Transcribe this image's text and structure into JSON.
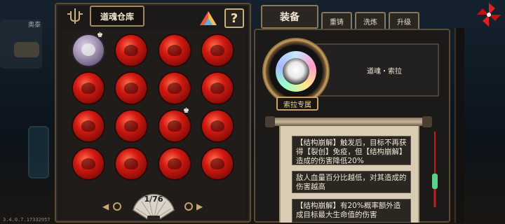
{
  "backdrop": {
    "overhead_label": "奥泰",
    "version": "3.4.0.7.17332957"
  },
  "left_panel": {
    "title": "道魂仓库",
    "help_label": "?",
    "page": "1/76",
    "prev_label": "◀",
    "next_label": "▶"
  },
  "orbs": [
    {
      "kind": "gray",
      "badge": "♚"
    },
    {
      "kind": "red"
    },
    {
      "kind": "red"
    },
    {
      "kind": "red"
    },
    {
      "kind": "red"
    },
    {
      "kind": "red"
    },
    {
      "kind": "red"
    },
    {
      "kind": "red"
    },
    {
      "kind": "red"
    },
    {
      "kind": "red"
    },
    {
      "kind": "red",
      "badge": "♚"
    },
    {
      "kind": "red"
    },
    {
      "kind": "red"
    },
    {
      "kind": "red"
    },
    {
      "kind": "red"
    },
    {
      "kind": "red"
    }
  ],
  "right_panel": {
    "equip_tab": "装备",
    "tabs": [
      "重铸",
      "洗炼",
      "升级"
    ],
    "item_name": "道魂・索拉",
    "exclusive_tag": "索拉专属",
    "descriptions": [
      "【结构崩解】触发后，目标不再获得【裂创】免疫，但【结构崩解】造成的伤害降低20%",
      "敌人血量百分比越低，对其造成的伤害越高",
      "【结构崩解】有20%概率额外造成目标最大生命值的伤害"
    ]
  },
  "colors": {
    "frame": "#5c4a32",
    "gold": "#c8a060",
    "panel": "#1c1a19",
    "orb_red": "#d21a12"
  },
  "icons": {
    "ornament": "fork-ornament-icon",
    "sort": "triangle-sort-icon",
    "close": "pinwheel-close-icon",
    "fan": "paper-fan-icon"
  }
}
